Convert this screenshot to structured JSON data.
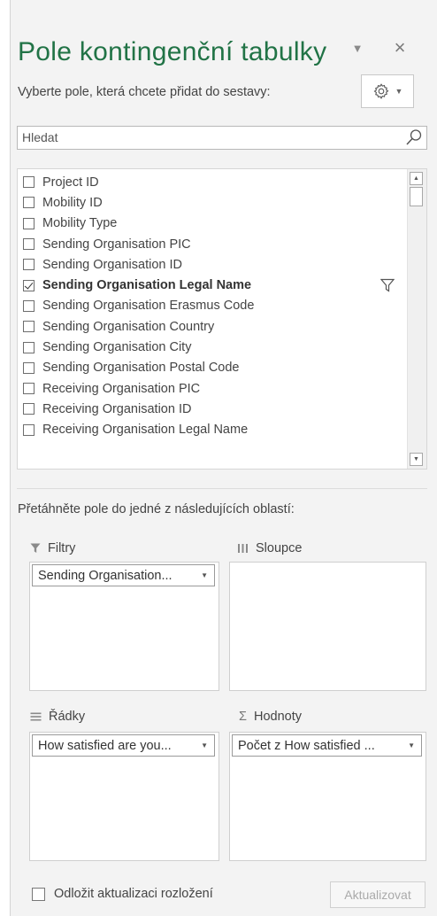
{
  "header": {
    "title": "Pole kontingenční tabulky",
    "subtitle": "Vyberte pole, která chcete přidat do sestavy:",
    "caret_icon": "chevron-down-icon",
    "close_label": "×",
    "settings_icon": "gear-icon"
  },
  "search": {
    "placeholder": "Hledat",
    "value": "",
    "icon": "search-icon"
  },
  "fields": [
    {
      "label": "Project ID",
      "checked": false
    },
    {
      "label": "Mobility ID",
      "checked": false
    },
    {
      "label": "Mobility Type",
      "checked": false
    },
    {
      "label": "Sending Organisation PIC",
      "checked": false
    },
    {
      "label": "Sending Organisation ID",
      "checked": false
    },
    {
      "label": "Sending Organisation Legal Name",
      "checked": true,
      "filtered": true
    },
    {
      "label": "Sending Organisation Erasmus Code",
      "checked": false
    },
    {
      "label": "Sending Organisation Country",
      "checked": false
    },
    {
      "label": "Sending Organisation City",
      "checked": false
    },
    {
      "label": "Sending Organisation Postal Code",
      "checked": false
    },
    {
      "label": "Receiving Organisation PIC",
      "checked": false
    },
    {
      "label": "Receiving Organisation ID",
      "checked": false
    },
    {
      "label": "Receiving Organisation Legal Name",
      "checked": false
    }
  ],
  "areas": {
    "hint": "Přetáhněte pole do jedné z následujících oblastí:",
    "filters": {
      "label": "Filtry",
      "icon": "filter-icon",
      "items": [
        "Sending Organisation..."
      ]
    },
    "columns": {
      "label": "Sloupce",
      "icon": "columns-icon",
      "items": []
    },
    "rows": {
      "label": "Řádky",
      "icon": "rows-icon",
      "items": [
        "How satisfied are you..."
      ]
    },
    "values": {
      "label": "Hodnoty",
      "icon": "sigma-icon",
      "symbol": "Σ",
      "items": [
        "Počet z How satisfied ..."
      ]
    }
  },
  "footer": {
    "defer_label": "Odložit aktualizaci rozložení",
    "defer_checked": false,
    "update_label": "Aktualizovat"
  }
}
